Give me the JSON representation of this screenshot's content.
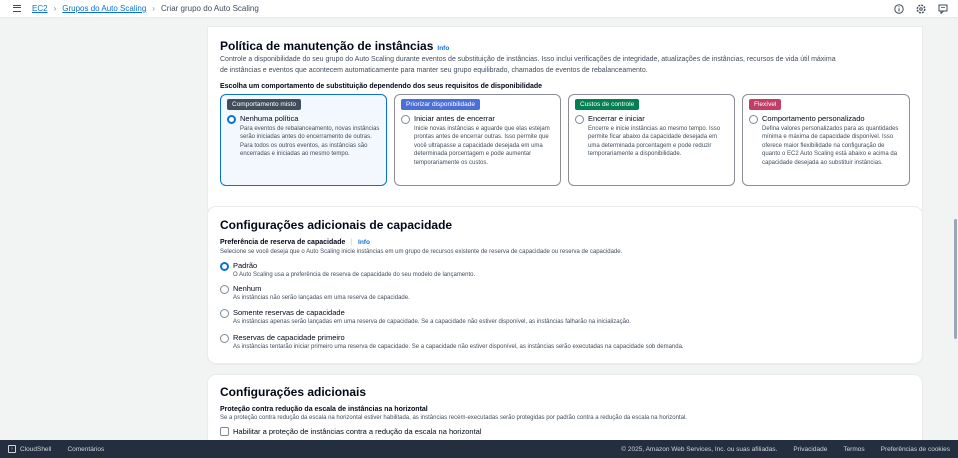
{
  "breadcrumb": {
    "items": [
      "EC2",
      "Grupos do Auto Scaling"
    ],
    "current": "Criar grupo do Auto Scaling"
  },
  "maintenance": {
    "title": "Política de manutenção de instâncias",
    "info": "Info",
    "description_line1": "Controle a disponibilidade do seu grupo do Auto Scaling durante eventos de substituição de instâncias. Isso inclui verificações de integridade, atualizações de instâncias, recursos de vida útil máxima",
    "description_line2": "de instâncias e eventos que acontecem automaticamente para manter seu grupo equilibrado, chamados de eventos de rebalanceamento.",
    "choose_label": "Escolha um comportamento de substituição dependendo dos seus requisitos de disponibilidade",
    "cards": [
      {
        "tag": "Comportamento misto",
        "tag_color": "#414d5c",
        "title": "Nenhuma política",
        "description": "Para eventos de rebalanceamento, novas instâncias serão iniciadas antes do encerramento de outras. Para todos os outros eventos, as instâncias são encerradas e iniciadas ao mesmo tempo.",
        "selected": true
      },
      {
        "tag": "Priorizar disponibilidade",
        "tag_color": "#4a6fd6",
        "title": "Iniciar antes de encerrar",
        "description": "Inicie novas instâncias e aguarde que elas estejam prontas antes de encerrar outras. Isso permite que você ultrapasse a capacidade desejada em uma determinada porcentagem e pode aumentar temporariamente os custos.",
        "selected": false
      },
      {
        "tag": "Custos de controle",
        "tag_color": "#037f51",
        "title": "Encerrar e iniciar",
        "description": "Encerre e inicie instâncias ao mesmo tempo. Isso permite ficar abaixo da capacidade desejada em uma determinada porcentagem e pode reduzir temporariamente a disponibilidade.",
        "selected": false
      },
      {
        "tag": "Flexível",
        "tag_color": "#c33d69",
        "title": "Comportamento personalizado",
        "description": "Defina valores personalizados para as quantidades mínima e máxima de capacidade disponível. Isso oferece maior flexibilidade na configuração de quanto o EC2 Auto Scaling está abaixo e acima da capacidade desejada ao substituir instâncias.",
        "selected": false
      }
    ]
  },
  "capacity": {
    "title": "Configurações adicionais de capacidade",
    "pref_label": "Preferência de reserva de capacidade",
    "info": "Info",
    "pref_description": "Selecione se você deseja que o Auto Scaling inicie instâncias em um grupo de recursos existente de reserva de capacidade ou reserva de capacidade.",
    "options": [
      {
        "title": "Padrão",
        "description": "O Auto Scaling usa a preferência de reserva de capacidade do seu modelo de lançamento.",
        "selected": true
      },
      {
        "title": "Nenhum",
        "description": "As instâncias não serão lançadas em uma reserva de capacidade.",
        "selected": false
      },
      {
        "title": "Somente reservas de capacidade",
        "description": "As instâncias apenas serão lançadas em uma reserva de capacidade. Se a capacidade não estiver disponível, as instâncias falharão na inicialização.",
        "selected": false
      },
      {
        "title": "Reservas de capacidade primeiro",
        "description": "As instâncias tentarão iniciar primeiro uma reserva de capacidade. Se a capacidade não estiver disponível, as instâncias serão executadas na capacidade sob demanda.",
        "selected": false
      }
    ]
  },
  "additional": {
    "title": "Configurações adicionais",
    "scale_in_label": "Proteção contra redução da escala de instâncias na horizontal",
    "scale_in_description": "Se a proteção contra redução da escala na horizontal estiver habilitada, as instâncias recém-executadas serão protegidas por padrão contra a redução da escala na horizontal.",
    "checkbox_label": "Habilitar a proteção de instâncias contra a redução da escala na horizontal"
  },
  "footer": {
    "cloudshell": "CloudShell",
    "comments": "Comentários",
    "copyright": "© 2025, Amazon Web Services, Inc. ou suas afiliadas.",
    "privacy": "Privacidade",
    "terms": "Termos",
    "cookies": "Preferências de cookies"
  },
  "icons": {
    "menu": "hamburger-menu-icon",
    "help": "info-circle-icon",
    "notifications": "gear-icon",
    "feedback": "chat-icon"
  },
  "colors": {
    "link": "#0972d3",
    "footer_bg": "#232f3e"
  }
}
